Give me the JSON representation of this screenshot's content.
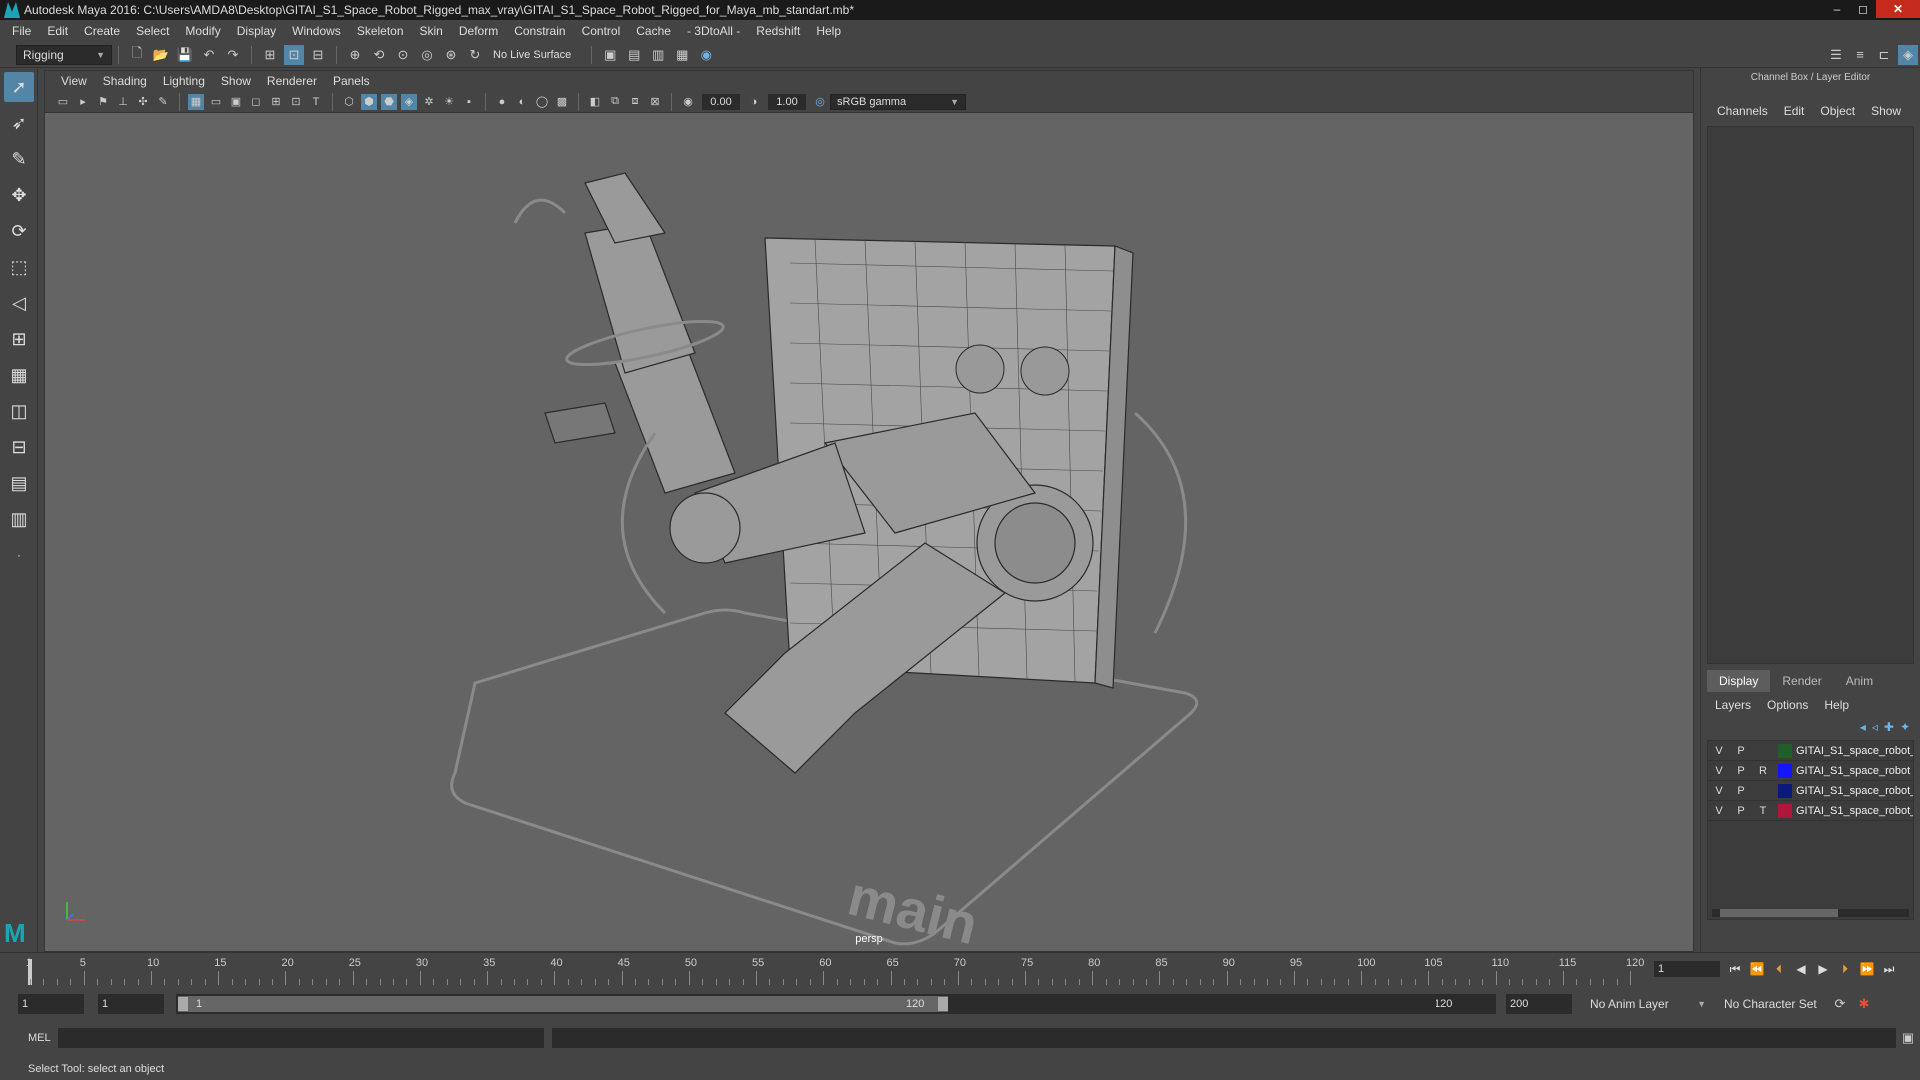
{
  "window": {
    "title": "Autodesk Maya 2016: C:\\Users\\AMDA8\\Desktop\\GITAI_S1_Space_Robot_Rigged_max_vray\\GITAI_S1_Space_Robot_Rigged_for_Maya_mb_standart.mb*",
    "minimize": "–",
    "maximize": "◻",
    "close": "✕"
  },
  "menubar": [
    "File",
    "Edit",
    "Create",
    "Select",
    "Modify",
    "Display",
    "Windows",
    "Skeleton",
    "Skin",
    "Deform",
    "Constrain",
    "Control",
    "Cache",
    "- 3DtoAll -",
    "Redshift",
    "Help"
  ],
  "shelf": {
    "menuset": "Rigging",
    "live_surface": "No Live Surface"
  },
  "panel": {
    "menu": [
      "View",
      "Shading",
      "Lighting",
      "Show",
      "Renderer",
      "Panels"
    ],
    "exposure": "0.00",
    "gamma": "1.00",
    "colorspace": "sRGB gamma",
    "camera_label": "persp",
    "ground_text": "main"
  },
  "channel_box": {
    "title": "Channel Box / Layer Editor",
    "menu": [
      "Channels",
      "Edit",
      "Object",
      "Show"
    ],
    "tabs": [
      "Display",
      "Render",
      "Anim"
    ],
    "submenu": [
      "Layers",
      "Options",
      "Help"
    ],
    "layers": [
      {
        "v": "V",
        "p": "P",
        "r": "",
        "color": "#1f5f2a",
        "name": "GITAI_S1_space_robot_"
      },
      {
        "v": "V",
        "p": "P",
        "r": "R",
        "color": "#1414ff",
        "name": "GITAI_S1_space_robot"
      },
      {
        "v": "V",
        "p": "P",
        "r": "",
        "color": "#0a1a7a",
        "name": "GITAI_S1_space_robot_"
      },
      {
        "v": "V",
        "p": "P",
        "r": "T",
        "color": "#b0163a",
        "name": "GITAI_S1_space_robot_"
      }
    ]
  },
  "timeline": {
    "ticks": [
      "1",
      "5",
      "10",
      "15",
      "20",
      "25",
      "30",
      "35",
      "40",
      "45",
      "50",
      "55",
      "60",
      "65",
      "70",
      "75",
      "80",
      "85",
      "90",
      "95",
      "100",
      "105",
      "110",
      "115",
      "120"
    ],
    "current_frame": "1",
    "range_start": 1,
    "range_end": 120,
    "max_frame": 120
  },
  "range_bar": {
    "start_frame": "1",
    "playback_start": "1",
    "slider_start": "1",
    "slider_end": "120",
    "playback_end": "120",
    "end_frame": "200",
    "anim_layer": "No Anim Layer",
    "character_set": "No Character Set"
  },
  "command_line": {
    "label": "MEL"
  },
  "help_line": {
    "text": "Select Tool: select an object"
  }
}
